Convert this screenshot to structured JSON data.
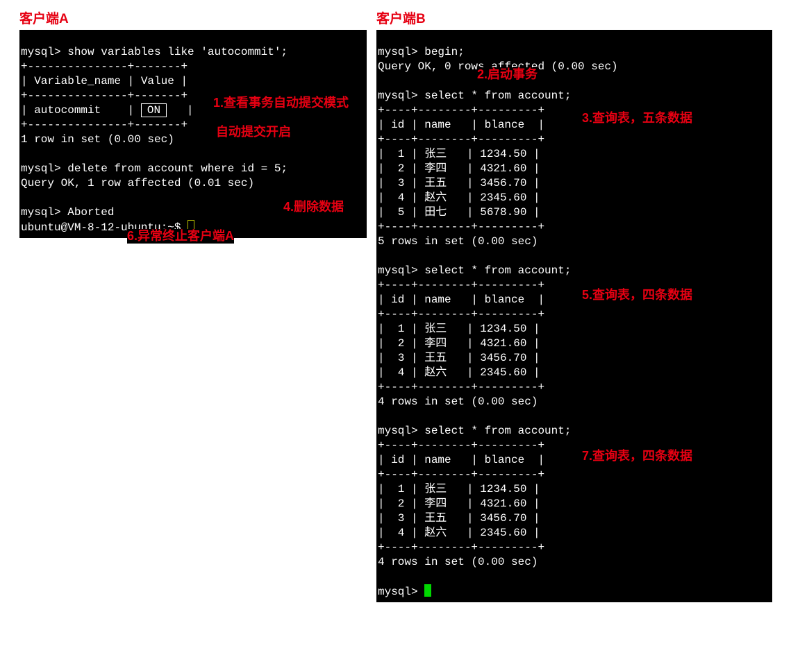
{
  "titles": {
    "a": "客户端A",
    "b": "客户端B"
  },
  "annotations": {
    "a1": "1.查看事务自动提交模式",
    "a2": "自动提交开启",
    "a4": "4.删除数据",
    "a6": "6.异常终止客户端A",
    "b2": "2.启动事务",
    "b3": "3.查询表，五条数据",
    "b5": "5.查询表，四条数据",
    "b7": "7.查询表，四条数据"
  },
  "clientA": {
    "cmd1": "mysql> show variables like 'autocommit';",
    "sep1": "+---------------+-------+",
    "hdr": "| Variable_name | Value |",
    "row": "| autocommit    |",
    "on_value": "ON",
    "row_end": "|",
    "rowsmsg": "1 row in set (0.00 sec)",
    "cmd2": "mysql> delete from account where id = 5;",
    "ok2": "Query OK, 1 row affected (0.01 sec)",
    "aborted_prefix": "mysql> Aborted",
    "shell": "ubuntu@VM-8-12-ubuntu:~$ "
  },
  "clientB": {
    "prompt_begin": "mysql> begin;",
    "ok_begin": "Query OK, 0 rows affected (0.00 sec)",
    "select_cmd": "mysql> select * from account;",
    "table_border": "+----+--------+---------+",
    "table_header": "| id | name   | blance  |",
    "rows5": [
      "|  1 | 张三   | 1234.50 |",
      "|  2 | 李四   | 4321.60 |",
      "|  3 | 王五   | 3456.70 |",
      "|  4 | 赵六   | 2345.60 |",
      "|  5 | 田七   | 5678.90 |"
    ],
    "msg5": "5 rows in set (0.00 sec)",
    "rows4": [
      "|  1 | 张三   | 1234.50 |",
      "|  2 | 李四   | 4321.60 |",
      "|  3 | 王五   | 3456.70 |",
      "|  4 | 赵六   | 2345.60 |"
    ],
    "msg4": "4 rows in set (0.00 sec)",
    "prompt_end": "mysql> "
  }
}
